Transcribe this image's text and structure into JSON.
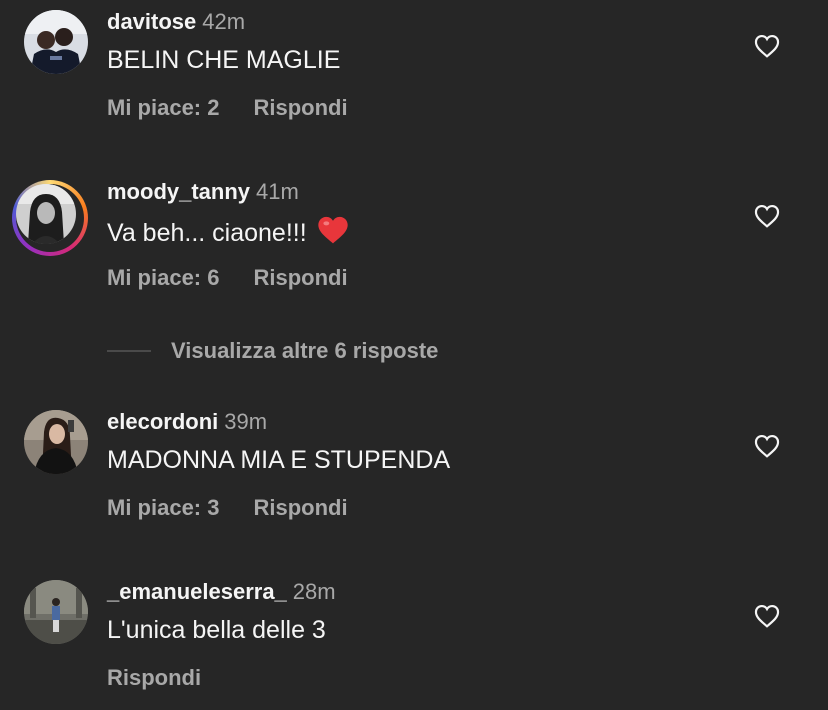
{
  "comments": [
    {
      "username": "davitose",
      "time": "42m",
      "text": "BELIN CHE MAGLIE",
      "likes_label": "Mi piace: 2",
      "reply_label": "Rispondi"
    },
    {
      "username": "moody_tanny",
      "time": "41m",
      "text": "Va beh... ciaone!!!",
      "emoji": "red-heart-icon",
      "likes_label": "Mi piace: 6",
      "reply_label": "Rispondi"
    },
    {
      "username": "elecordoni",
      "time": "39m",
      "text": "MADONNA MIA E STUPENDA",
      "likes_label": "Mi piace: 3",
      "reply_label": "Rispondi"
    },
    {
      "username": "_emanueleserra_",
      "time": "28m",
      "text": "L'unica bella delle 3",
      "reply_label": "Rispondi"
    }
  ],
  "view_more_replies": "Visualizza altre 6 risposte",
  "colors": {
    "background": "#262626",
    "primary_text": "#f5f5f5",
    "secondary_text": "#a8a8a8",
    "heart_emoji": "#e8363b"
  },
  "icons": {
    "like": "heart-outline-icon"
  }
}
